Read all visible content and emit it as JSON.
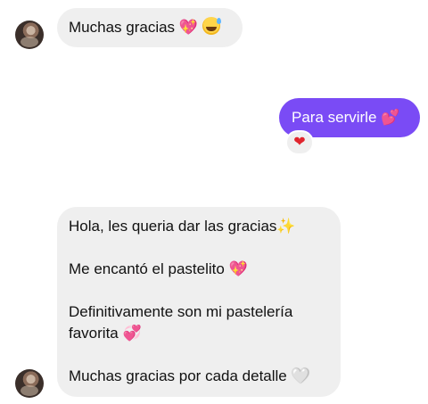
{
  "conversation": {
    "messages": [
      {
        "sender": "other",
        "text": "Muchas gracias",
        "emojis": [
          "💖",
          "😅"
        ]
      },
      {
        "sender": "self",
        "text": "Para servirle",
        "emoji": "💕",
        "reaction": "❤"
      },
      {
        "sender": "other",
        "paragraphs": [
          {
            "text": "Hola, les queria dar las gracias",
            "emoji": "✨"
          },
          {
            "text": "Me encantó el pastelito",
            "emoji": "💖"
          },
          {
            "text_line1": "Definitivamente son mi pastelería",
            "text_line2": "favorita",
            "emoji": "💞"
          },
          {
            "text": "Muchas gracias por cada detalle",
            "emoji": "🤍"
          }
        ]
      }
    ]
  },
  "colors": {
    "outgoing_bubble": "#7a4bf5",
    "incoming_bubble": "#efefef",
    "reaction_heart": "#e0242d"
  }
}
